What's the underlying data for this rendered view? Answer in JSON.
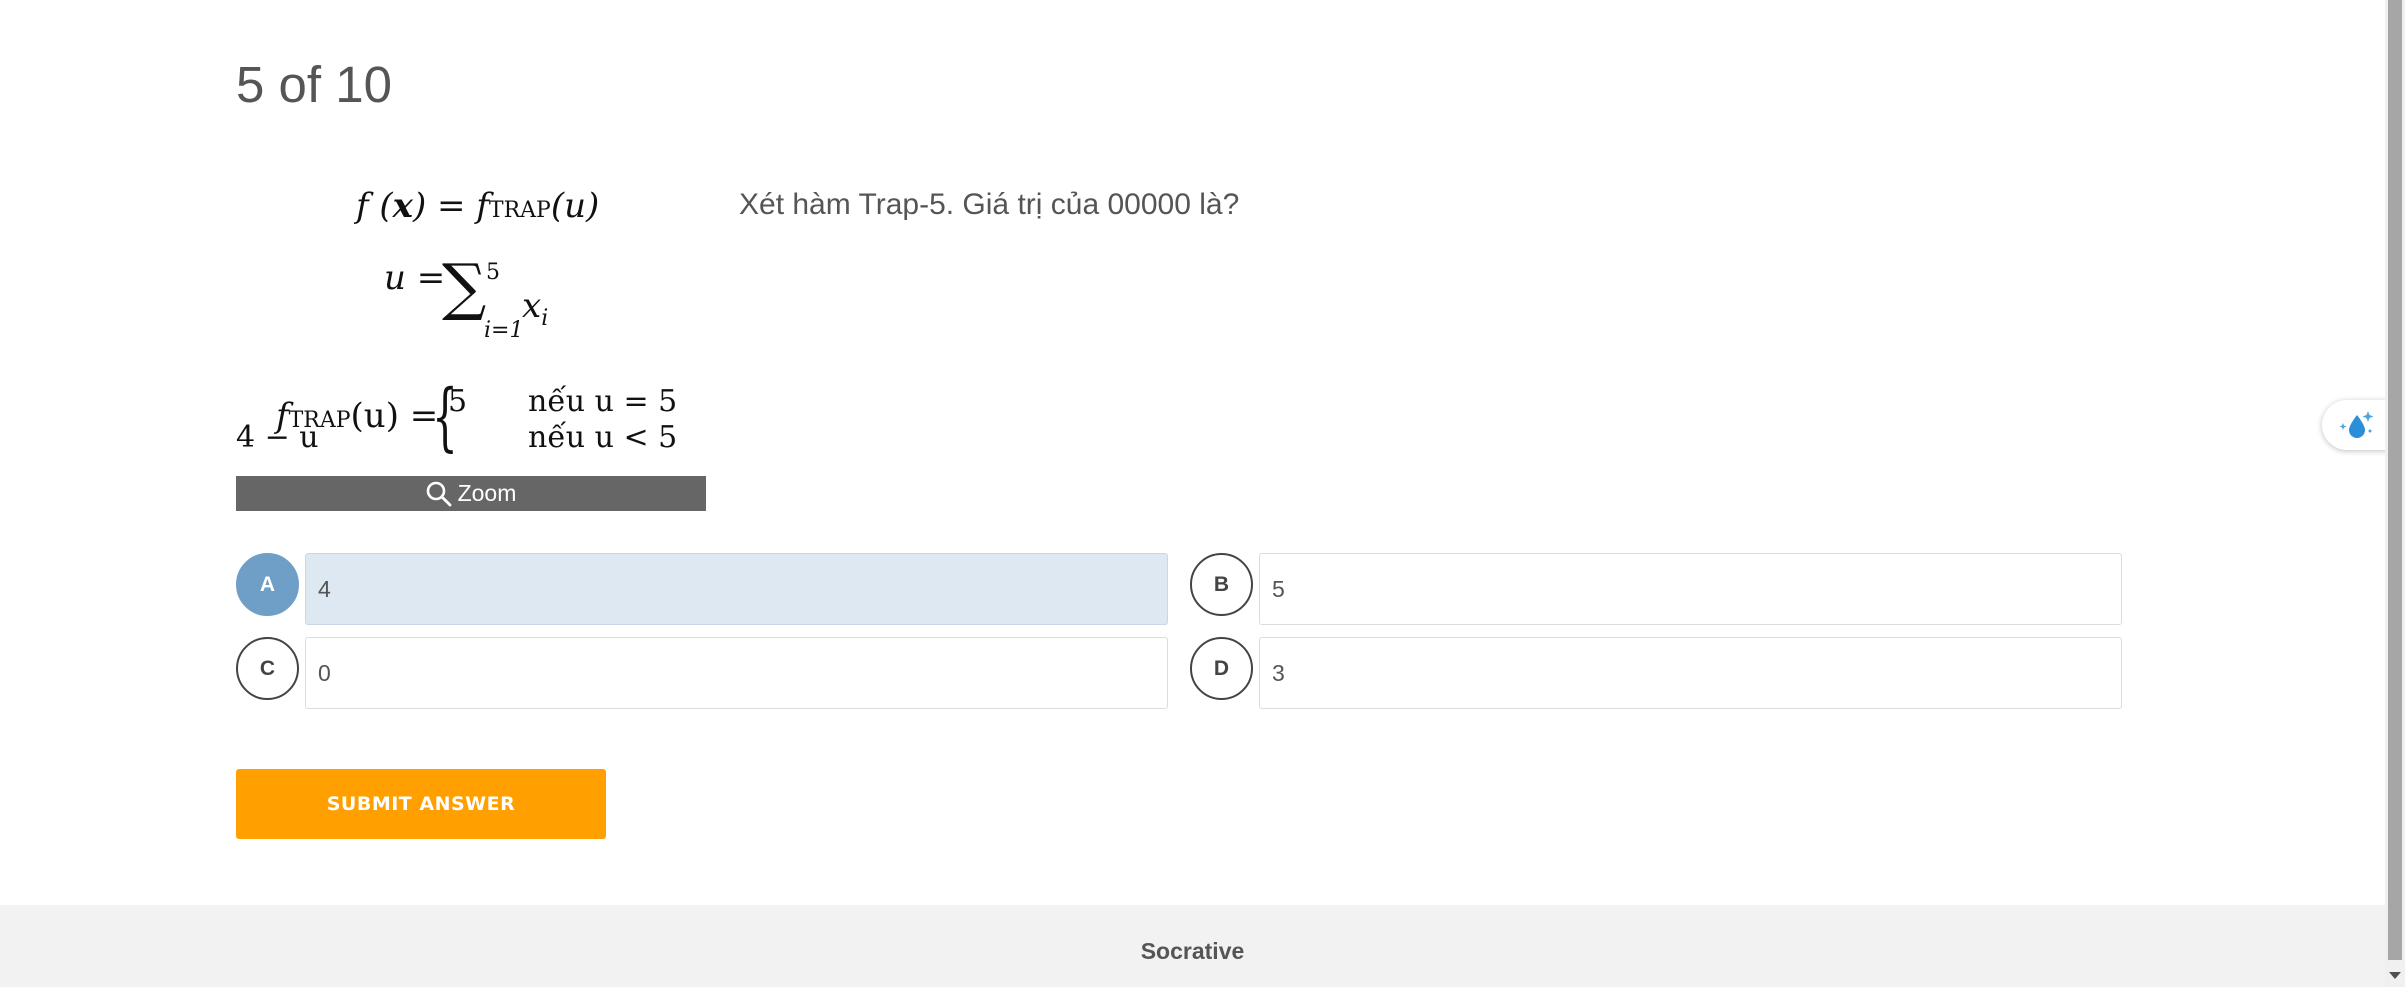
{
  "header": {
    "progress": "5 of 10"
  },
  "formula": {
    "line1_lhs": "f (",
    "line1_x": "x",
    "line1_mid": ") = f",
    "line1_sub": "TRAP",
    "line1_rhs": "(u)",
    "line2_lhs": "u =",
    "sigma": "∑",
    "sigma_upper": "5",
    "sigma_lower": "i=1",
    "sigma_term": "x",
    "sigma_term_sub": "i",
    "line3_lhs": "f",
    "line3_sub": "TRAP",
    "line3_rhs": "(u) =",
    "case1_value": "5",
    "case1_condition": "nếu u = 5",
    "case2_value": "4 − u",
    "case2_condition": "nếu u < 5"
  },
  "zoom": {
    "label": "Zoom",
    "icon": "magnifier-icon"
  },
  "question": {
    "text": "Xét hàm Trap-5. Giá trị của 00000 là?"
  },
  "choices": [
    {
      "letter": "A",
      "value": "4",
      "selected": true
    },
    {
      "letter": "B",
      "value": "5",
      "selected": false
    },
    {
      "letter": "C",
      "value": "0",
      "selected": false
    },
    {
      "letter": "D",
      "value": "3",
      "selected": false
    }
  ],
  "submit": {
    "label": "SUBMIT ANSWER"
  },
  "footer": {
    "brand": "Socrative"
  },
  "colors": {
    "accent": "#ff9f00",
    "selected_letter": "#6f9ec7",
    "selected_box": "#dde8f2",
    "zoom_bar": "#666666"
  }
}
